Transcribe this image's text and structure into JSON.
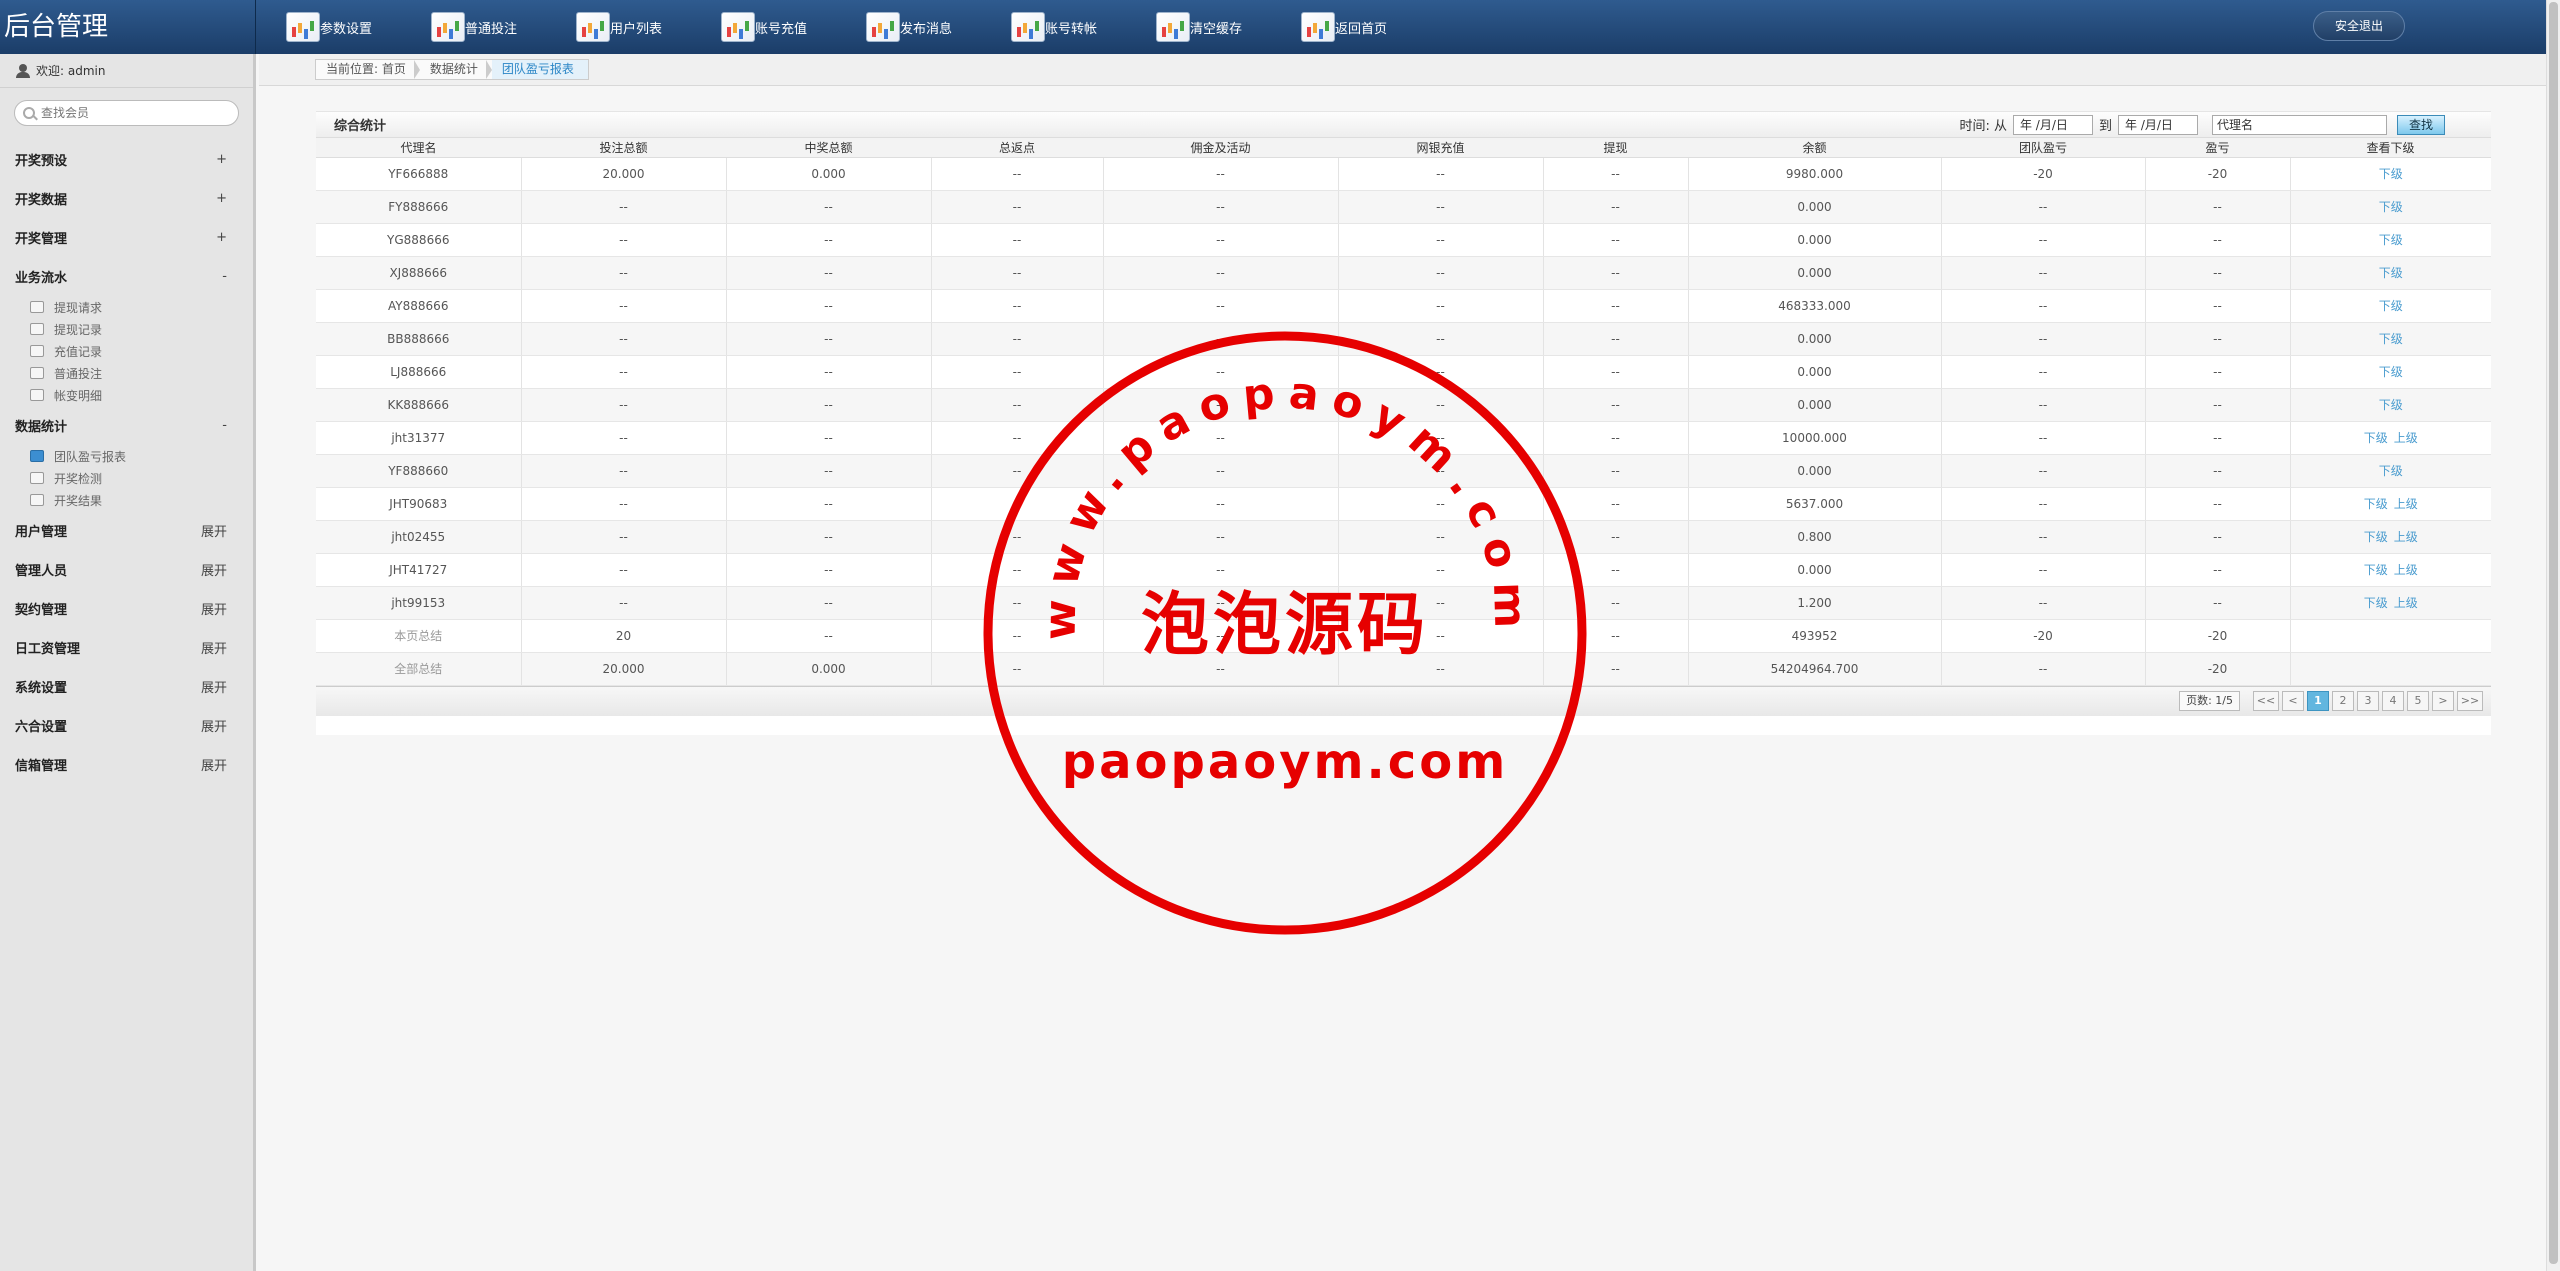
{
  "header": {
    "logo": "后台管理",
    "nav": [
      {
        "label": "参数设置",
        "icon": "chart-icon"
      },
      {
        "label": "普通投注",
        "icon": "chart-icon"
      },
      {
        "label": "用户列表",
        "icon": "chart-icon"
      },
      {
        "label": "账号充值",
        "icon": "chart-icon"
      },
      {
        "label": "发布消息",
        "icon": "chart-icon"
      },
      {
        "label": "账号转帐",
        "icon": "chart-icon"
      },
      {
        "label": "清空缓存",
        "icon": "chart-icon"
      },
      {
        "label": "返回首页",
        "icon": "chart-icon"
      }
    ],
    "logout": "安全退出"
  },
  "sidebar": {
    "welcome": "欢迎: admin",
    "search_placeholder": "查找会员",
    "groups": [
      {
        "label": "开奖预设",
        "toggle": "+"
      },
      {
        "label": "开奖数据",
        "toggle": "+"
      },
      {
        "label": "开奖管理",
        "toggle": "+"
      },
      {
        "label": "业务流水",
        "toggle": "-",
        "items": [
          "提现请求",
          "提现记录",
          "充值记录",
          "普通投注",
          "帐变明细"
        ]
      },
      {
        "label": "数据统计",
        "toggle": "-",
        "items": [
          "团队盈亏报表",
          "开奖检测",
          "开奖结果"
        ]
      },
      {
        "label": "用户管理",
        "toggle": "展开"
      },
      {
        "label": "管理人员",
        "toggle": "展开"
      },
      {
        "label": "契约管理",
        "toggle": "展开"
      },
      {
        "label": "日工资管理",
        "toggle": "展开"
      },
      {
        "label": "系统设置",
        "toggle": "展开"
      },
      {
        "label": "六合设置",
        "toggle": "展开"
      },
      {
        "label": "信箱管理",
        "toggle": "展开"
      }
    ]
  },
  "breadcrumb": [
    "当前位置: 首页",
    "数据统计",
    "团队盈亏报表"
  ],
  "panel": {
    "title": "综合统计",
    "filter": {
      "time_label": "时间: 从",
      "date_from": "年 /月/日",
      "to_label": "到",
      "date_to": "年 /月/日",
      "agent_placeholder": "代理名",
      "search_button": "查找"
    }
  },
  "table": {
    "columns": [
      "代理名",
      "投注总额",
      "中奖总额",
      "总返点",
      "佣金及活动",
      "网银充值",
      "提现",
      "余额",
      "团队盈亏",
      "盈亏",
      "查看下级"
    ],
    "rows": [
      {
        "cells": [
          "YF666888",
          "20.000",
          "0.000",
          "--",
          "--",
          "--",
          "--",
          "9980.000",
          "-20",
          "-20"
        ],
        "links": [
          "下级"
        ]
      },
      {
        "cells": [
          "FY888666",
          "--",
          "--",
          "--",
          "--",
          "--",
          "--",
          "0.000",
          "--",
          "--"
        ],
        "links": [
          "下级"
        ]
      },
      {
        "cells": [
          "YG888666",
          "--",
          "--",
          "--",
          "--",
          "--",
          "--",
          "0.000",
          "--",
          "--"
        ],
        "links": [
          "下级"
        ]
      },
      {
        "cells": [
          "XJ888666",
          "--",
          "--",
          "--",
          "--",
          "--",
          "--",
          "0.000",
          "--",
          "--"
        ],
        "links": [
          "下级"
        ]
      },
      {
        "cells": [
          "AY888666",
          "--",
          "--",
          "--",
          "--",
          "--",
          "--",
          "468333.000",
          "--",
          "--"
        ],
        "links": [
          "下级"
        ]
      },
      {
        "cells": [
          "BB888666",
          "--",
          "--",
          "--",
          "--",
          "--",
          "--",
          "0.000",
          "--",
          "--"
        ],
        "links": [
          "下级"
        ]
      },
      {
        "cells": [
          "LJ888666",
          "--",
          "--",
          "--",
          "--",
          "--",
          "--",
          "0.000",
          "--",
          "--"
        ],
        "links": [
          "下级"
        ]
      },
      {
        "cells": [
          "KK888666",
          "--",
          "--",
          "--",
          "--",
          "--",
          "--",
          "0.000",
          "--",
          "--"
        ],
        "links": [
          "下级"
        ]
      },
      {
        "cells": [
          "jht31377",
          "--",
          "--",
          "--",
          "--",
          "--",
          "--",
          "10000.000",
          "--",
          "--"
        ],
        "links": [
          "下级",
          "上级"
        ]
      },
      {
        "cells": [
          "YF888660",
          "--",
          "--",
          "--",
          "--",
          "--",
          "--",
          "0.000",
          "--",
          "--"
        ],
        "links": [
          "下级"
        ]
      },
      {
        "cells": [
          "JHT90683",
          "--",
          "--",
          "--",
          "--",
          "--",
          "--",
          "5637.000",
          "--",
          "--"
        ],
        "links": [
          "下级",
          "上级"
        ]
      },
      {
        "cells": [
          "jht02455",
          "--",
          "--",
          "--",
          "--",
          "--",
          "--",
          "0.800",
          "--",
          "--"
        ],
        "links": [
          "下级",
          "上级"
        ]
      },
      {
        "cells": [
          "JHT41727",
          "--",
          "--",
          "--",
          "--",
          "--",
          "--",
          "0.000",
          "--",
          "--"
        ],
        "links": [
          "下级",
          "上级"
        ]
      },
      {
        "cells": [
          "jht99153",
          "--",
          "--",
          "--",
          "--",
          "--",
          "--",
          "1.200",
          "--",
          "--"
        ],
        "links": [
          "下级",
          "上级"
        ]
      }
    ],
    "page_total": [
      "本页总结",
      "20",
      "--",
      "--",
      "--",
      "--",
      "--",
      "493952",
      "-20",
      "-20",
      ""
    ],
    "grand_total": [
      "全部总结",
      "20.000",
      "0.000",
      "--",
      "--",
      "--",
      "--",
      "54204964.700",
      "--",
      "-20",
      ""
    ]
  },
  "pager": {
    "info": "页数: 1/5",
    "first": "<<",
    "prev": "<",
    "pages": [
      "1",
      "2",
      "3",
      "4",
      "5"
    ],
    "current": "1",
    "next": ">",
    "last": ">>"
  },
  "watermark": {
    "arc_text": "www.paopaoym.com",
    "center_text": "泡泡源码",
    "bottom_text": "paopaoym.com",
    "color": "#e60000"
  }
}
